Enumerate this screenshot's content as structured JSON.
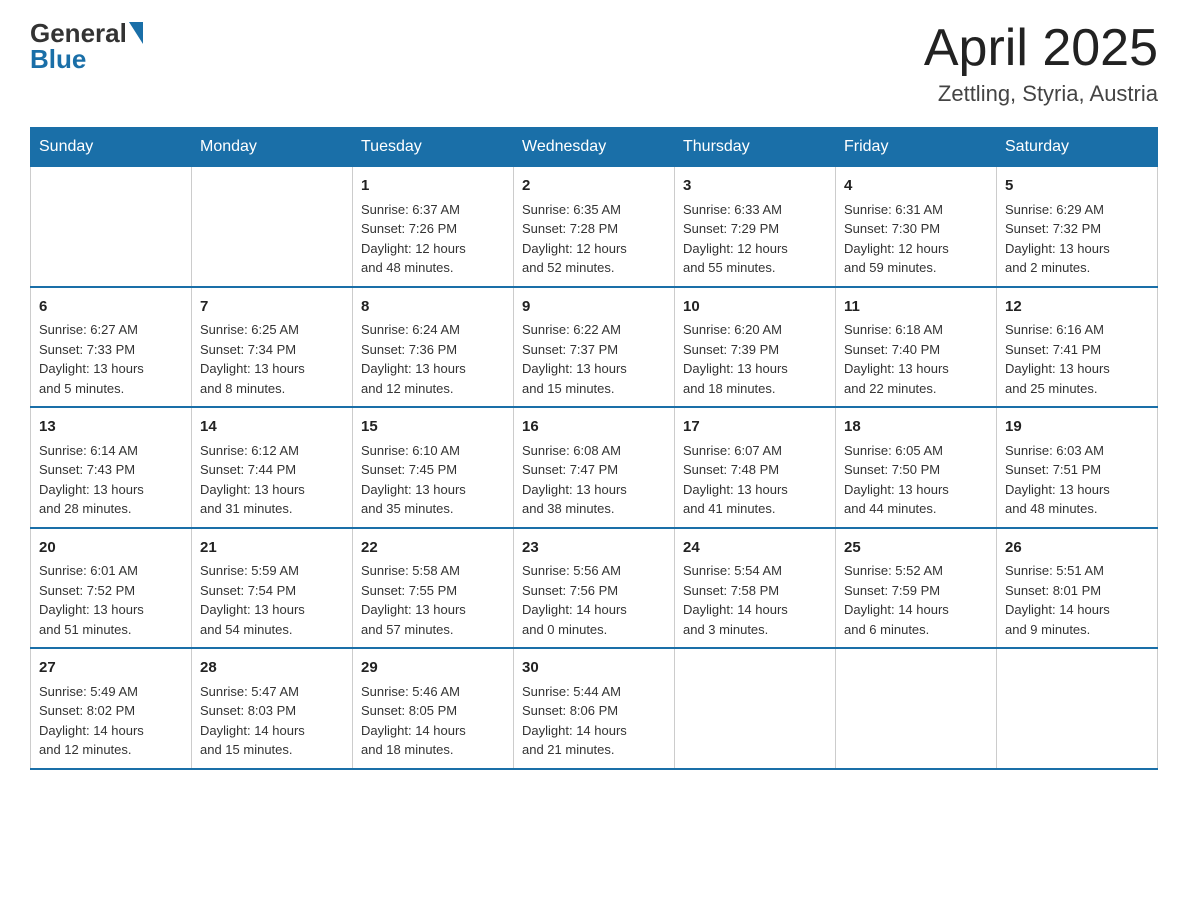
{
  "header": {
    "logo_general": "General",
    "logo_blue": "Blue",
    "title": "April 2025",
    "subtitle": "Zettling, Styria, Austria"
  },
  "days_of_week": [
    "Sunday",
    "Monday",
    "Tuesday",
    "Wednesday",
    "Thursday",
    "Friday",
    "Saturday"
  ],
  "weeks": [
    [
      {
        "day": "",
        "info": ""
      },
      {
        "day": "",
        "info": ""
      },
      {
        "day": "1",
        "info": "Sunrise: 6:37 AM\nSunset: 7:26 PM\nDaylight: 12 hours\nand 48 minutes."
      },
      {
        "day": "2",
        "info": "Sunrise: 6:35 AM\nSunset: 7:28 PM\nDaylight: 12 hours\nand 52 minutes."
      },
      {
        "day": "3",
        "info": "Sunrise: 6:33 AM\nSunset: 7:29 PM\nDaylight: 12 hours\nand 55 minutes."
      },
      {
        "day": "4",
        "info": "Sunrise: 6:31 AM\nSunset: 7:30 PM\nDaylight: 12 hours\nand 59 minutes."
      },
      {
        "day": "5",
        "info": "Sunrise: 6:29 AM\nSunset: 7:32 PM\nDaylight: 13 hours\nand 2 minutes."
      }
    ],
    [
      {
        "day": "6",
        "info": "Sunrise: 6:27 AM\nSunset: 7:33 PM\nDaylight: 13 hours\nand 5 minutes."
      },
      {
        "day": "7",
        "info": "Sunrise: 6:25 AM\nSunset: 7:34 PM\nDaylight: 13 hours\nand 8 minutes."
      },
      {
        "day": "8",
        "info": "Sunrise: 6:24 AM\nSunset: 7:36 PM\nDaylight: 13 hours\nand 12 minutes."
      },
      {
        "day": "9",
        "info": "Sunrise: 6:22 AM\nSunset: 7:37 PM\nDaylight: 13 hours\nand 15 minutes."
      },
      {
        "day": "10",
        "info": "Sunrise: 6:20 AM\nSunset: 7:39 PM\nDaylight: 13 hours\nand 18 minutes."
      },
      {
        "day": "11",
        "info": "Sunrise: 6:18 AM\nSunset: 7:40 PM\nDaylight: 13 hours\nand 22 minutes."
      },
      {
        "day": "12",
        "info": "Sunrise: 6:16 AM\nSunset: 7:41 PM\nDaylight: 13 hours\nand 25 minutes."
      }
    ],
    [
      {
        "day": "13",
        "info": "Sunrise: 6:14 AM\nSunset: 7:43 PM\nDaylight: 13 hours\nand 28 minutes."
      },
      {
        "day": "14",
        "info": "Sunrise: 6:12 AM\nSunset: 7:44 PM\nDaylight: 13 hours\nand 31 minutes."
      },
      {
        "day": "15",
        "info": "Sunrise: 6:10 AM\nSunset: 7:45 PM\nDaylight: 13 hours\nand 35 minutes."
      },
      {
        "day": "16",
        "info": "Sunrise: 6:08 AM\nSunset: 7:47 PM\nDaylight: 13 hours\nand 38 minutes."
      },
      {
        "day": "17",
        "info": "Sunrise: 6:07 AM\nSunset: 7:48 PM\nDaylight: 13 hours\nand 41 minutes."
      },
      {
        "day": "18",
        "info": "Sunrise: 6:05 AM\nSunset: 7:50 PM\nDaylight: 13 hours\nand 44 minutes."
      },
      {
        "day": "19",
        "info": "Sunrise: 6:03 AM\nSunset: 7:51 PM\nDaylight: 13 hours\nand 48 minutes."
      }
    ],
    [
      {
        "day": "20",
        "info": "Sunrise: 6:01 AM\nSunset: 7:52 PM\nDaylight: 13 hours\nand 51 minutes."
      },
      {
        "day": "21",
        "info": "Sunrise: 5:59 AM\nSunset: 7:54 PM\nDaylight: 13 hours\nand 54 minutes."
      },
      {
        "day": "22",
        "info": "Sunrise: 5:58 AM\nSunset: 7:55 PM\nDaylight: 13 hours\nand 57 minutes."
      },
      {
        "day": "23",
        "info": "Sunrise: 5:56 AM\nSunset: 7:56 PM\nDaylight: 14 hours\nand 0 minutes."
      },
      {
        "day": "24",
        "info": "Sunrise: 5:54 AM\nSunset: 7:58 PM\nDaylight: 14 hours\nand 3 minutes."
      },
      {
        "day": "25",
        "info": "Sunrise: 5:52 AM\nSunset: 7:59 PM\nDaylight: 14 hours\nand 6 minutes."
      },
      {
        "day": "26",
        "info": "Sunrise: 5:51 AM\nSunset: 8:01 PM\nDaylight: 14 hours\nand 9 minutes."
      }
    ],
    [
      {
        "day": "27",
        "info": "Sunrise: 5:49 AM\nSunset: 8:02 PM\nDaylight: 14 hours\nand 12 minutes."
      },
      {
        "day": "28",
        "info": "Sunrise: 5:47 AM\nSunset: 8:03 PM\nDaylight: 14 hours\nand 15 minutes."
      },
      {
        "day": "29",
        "info": "Sunrise: 5:46 AM\nSunset: 8:05 PM\nDaylight: 14 hours\nand 18 minutes."
      },
      {
        "day": "30",
        "info": "Sunrise: 5:44 AM\nSunset: 8:06 PM\nDaylight: 14 hours\nand 21 minutes."
      },
      {
        "day": "",
        "info": ""
      },
      {
        "day": "",
        "info": ""
      },
      {
        "day": "",
        "info": ""
      }
    ]
  ]
}
